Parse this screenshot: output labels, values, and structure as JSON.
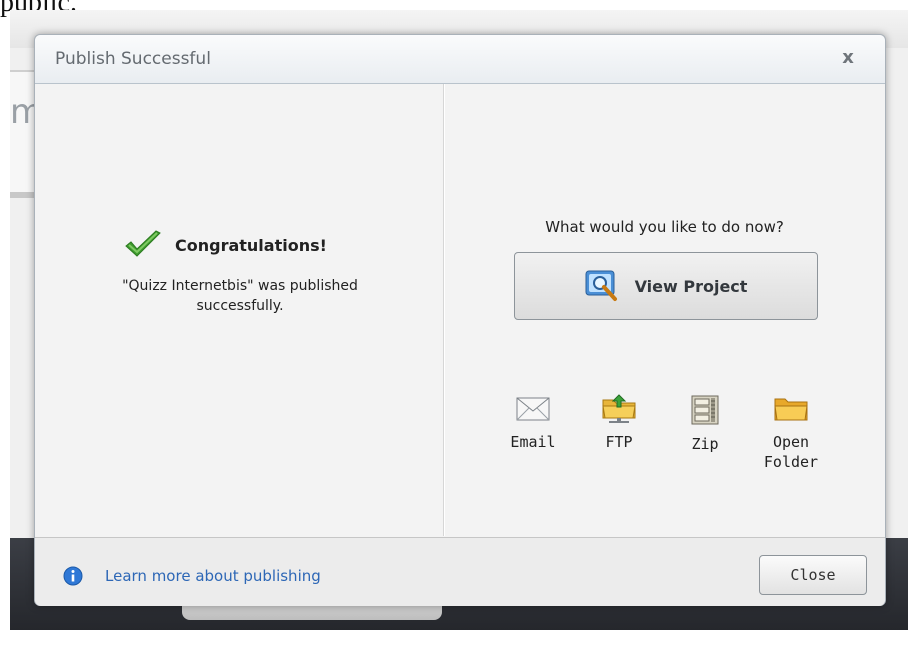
{
  "page": {
    "caption": "public."
  },
  "background": {
    "partial_letter": "m"
  },
  "dialog": {
    "title": "Publish Successful",
    "close_glyph": "x",
    "left": {
      "icon": "checkmark-icon",
      "heading": "Congratulations!",
      "message_line1": "\"Quizz Internetbis\" was published",
      "message_line2": "successfully."
    },
    "right": {
      "question": "What would you like to do now?",
      "view_project": {
        "label": "View Project",
        "icon": "magnifier-icon"
      },
      "actions": [
        {
          "label": "Email",
          "icon": "envelope-icon"
        },
        {
          "label": "FTP",
          "icon": "ftp-folder-icon"
        },
        {
          "label": "Zip",
          "icon": "zip-archive-icon"
        },
        {
          "label_line1": "Open",
          "label_line2": "Folder",
          "icon": "folder-icon"
        }
      ]
    },
    "footer": {
      "info_icon": "info-icon",
      "learn_link": "Learn more about publishing",
      "close_label": "Close"
    }
  },
  "colors": {
    "link": "#2d67b6",
    "check": "#3e9a2e",
    "title_text": "#646a70",
    "dark_bar": "#2f3137"
  }
}
